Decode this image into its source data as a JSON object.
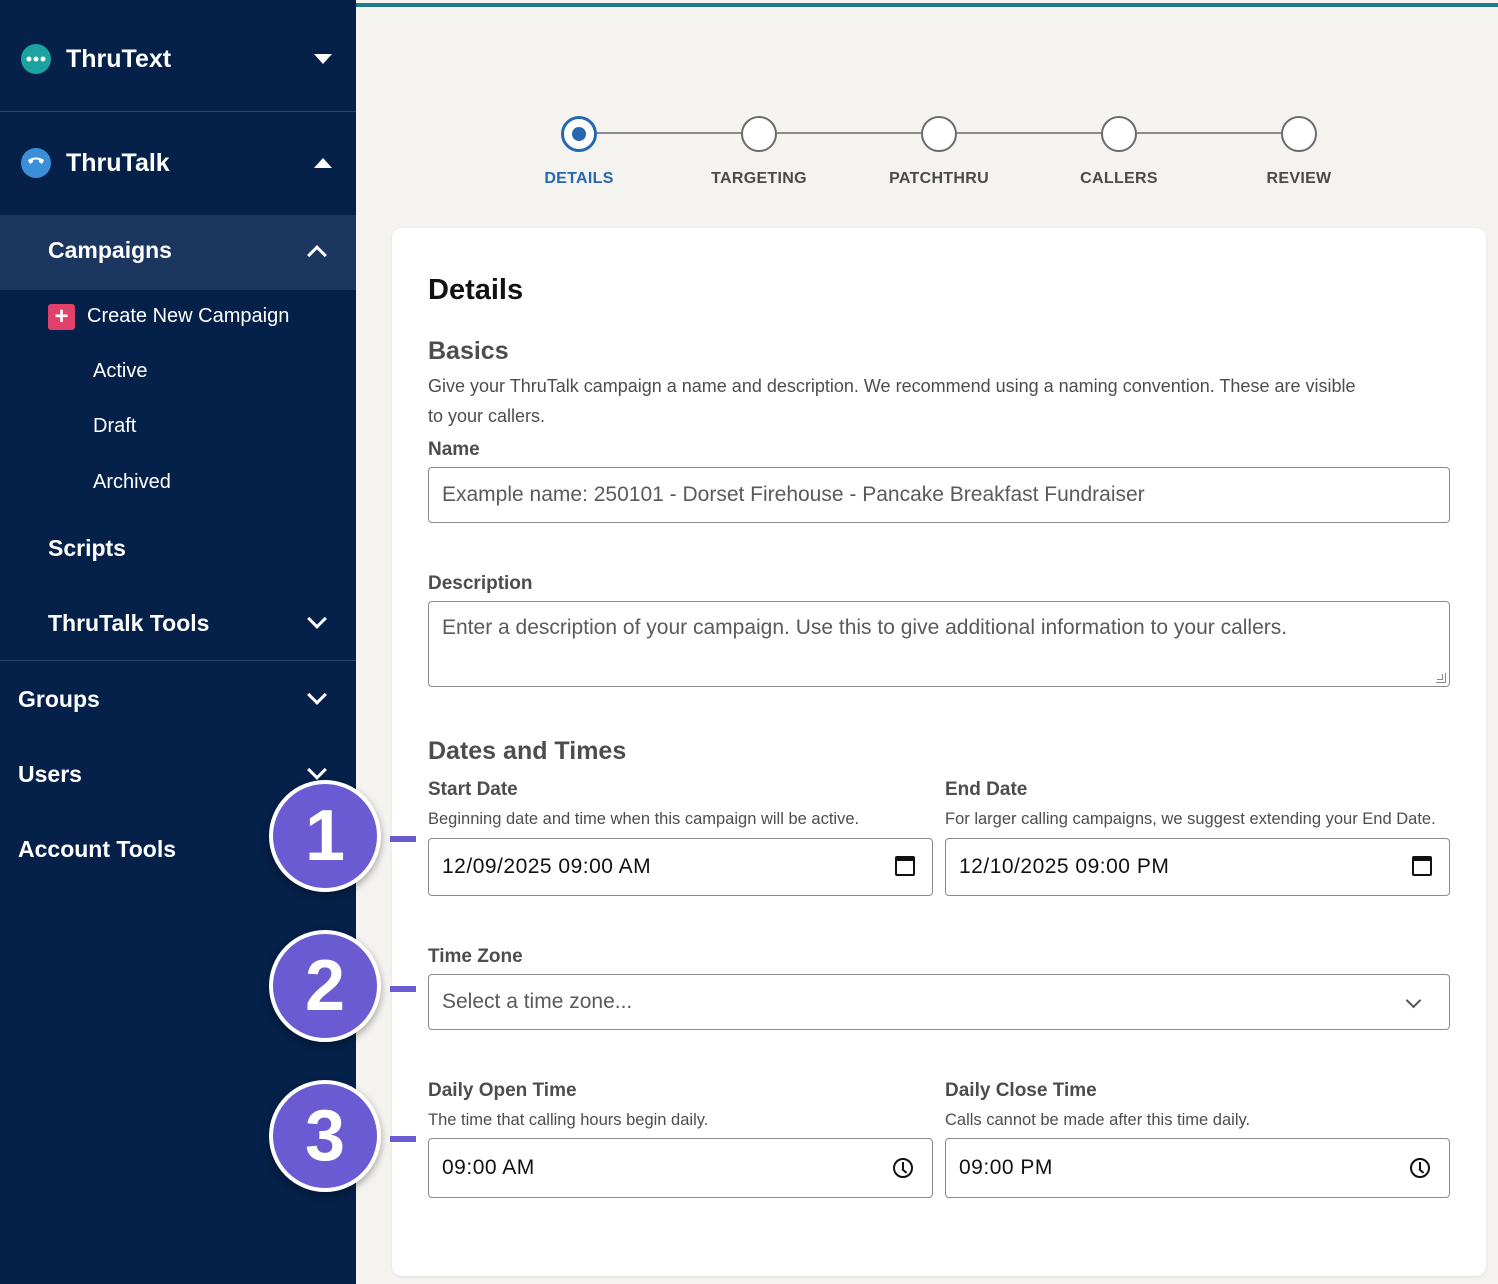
{
  "sidebar": {
    "products": [
      {
        "label": "ThruText",
        "icon": "thrutext-logo-icon",
        "expanded": false
      },
      {
        "label": "ThruTalk",
        "icon": "thrutalk-logo-icon",
        "expanded": true
      }
    ],
    "campaigns": {
      "label": "Campaigns",
      "create_label": "Create New Campaign",
      "items": [
        "Active",
        "Draft",
        "Archived"
      ]
    },
    "scripts_label": "Scripts",
    "tools_label": "ThruTalk Tools",
    "groups_label": "Groups",
    "users_label": "Users",
    "account_tools_label": "Account Tools"
  },
  "stepper": {
    "steps": [
      "DETAILS",
      "TARGETING",
      "PATCHTHRU",
      "CALLERS",
      "REVIEW"
    ],
    "active_step": "DETAILS"
  },
  "form": {
    "title": "Details",
    "basics": {
      "heading": "Basics",
      "help_line1": "Give your ThruTalk campaign a name and description. We recommend using a naming convention. These are visible",
      "help_line2": "to your callers.",
      "name_label": "Name",
      "name_placeholder": "Example name: 250101 - Dorset Firehouse - Pancake Breakfast Fundraiser",
      "description_label": "Description",
      "description_placeholder": "Enter a description of your campaign. Use this to give additional information to your callers."
    },
    "dates": {
      "heading": "Dates and Times",
      "start_label": "Start Date",
      "start_help": "Beginning date and time when this campaign will be active.",
      "start_value": "12/09/2025 09:00 AM",
      "end_label": "End Date",
      "end_help": "For larger calling campaigns, we suggest extending your End Date.",
      "end_value": "12/10/2025 09:00 PM",
      "timezone_label": "Time Zone",
      "timezone_placeholder": "Select a time zone...",
      "open_label": "Daily Open Time",
      "open_help": "The time that calling hours begin daily.",
      "open_value": "09:00 AM",
      "close_label": "Daily Close Time",
      "close_help": "Calls cannot be made after this time daily.",
      "close_value": "09:00 PM"
    }
  },
  "callouts": [
    "1",
    "2",
    "3"
  ],
  "colors": {
    "sidebar_bg": "#052149",
    "active_nav_bg": "#1b365f",
    "accent_blue": "#2766b0",
    "callout_purple": "#6b5bd3",
    "create_plus": "#e0416a",
    "top_accent": "#1f7a87"
  }
}
